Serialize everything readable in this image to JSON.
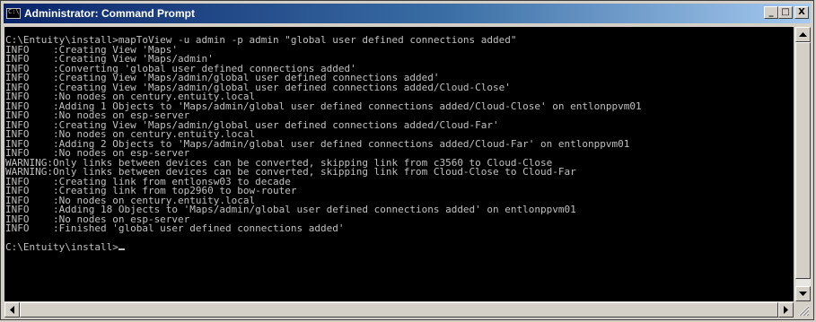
{
  "window": {
    "title": "Administrator: Command Prompt",
    "app_icon_text": "C:\\",
    "buttons": {
      "minimize": "_",
      "maximize": "□",
      "close": "X"
    }
  },
  "console": {
    "lines": [
      "C:\\Entuity\\install>mapToView -u admin -p admin \"global user defined connections added\"",
      "INFO    :Creating View 'Maps'",
      "INFO    :Creating View 'Maps/admin'",
      "INFO    :Converting 'global user defined connections added'",
      "INFO    :Creating View 'Maps/admin/global user defined connections added'",
      "INFO    :Creating View 'Maps/admin/global user defined connections added/Cloud-Close'",
      "INFO    :No nodes on century.entuity.local",
      "INFO    :Adding 1 Objects to 'Maps/admin/global user defined connections added/Cloud-Close' on entlonppvm01",
      "INFO    :No nodes on esp-server",
      "INFO    :Creating View 'Maps/admin/global user defined connections added/Cloud-Far'",
      "INFO    :No nodes on century.entuity.local",
      "INFO    :Adding 2 Objects to 'Maps/admin/global user defined connections added/Cloud-Far' on entlonppvm01",
      "INFO    :No nodes on esp-server",
      "WARNING:Only links between devices can be converted, skipping link from c3560 to Cloud-Close",
      "WARNING:Only links between devices can be converted, skipping link from Cloud-Close to Cloud-Far",
      "INFO    :Creating link from entlonsw03 to decade",
      "INFO    :Creating link from top2960 to bow-router",
      "INFO    :No nodes on century.entuity.local",
      "INFO    :Adding 18 Objects to 'Maps/admin/global user defined connections added' on entlonppvm01",
      "INFO    :No nodes on esp-server",
      "INFO    :Finished 'global user defined connections added'",
      "",
      "C:\\Entuity\\install>"
    ]
  },
  "colors": {
    "console_background": "#000000",
    "console_text": "#c0c0c0",
    "titlebar_start": "#0a246a",
    "titlebar_end": "#a6caf0",
    "titlebar_text": "#ffffff"
  },
  "icons": {
    "app": "console-app-icon",
    "scroll_up": "arrow-up-icon",
    "scroll_down": "arrow-down-icon",
    "scroll_left": "arrow-left-icon",
    "scroll_right": "arrow-right-icon",
    "resize": "resize-grip-icon"
  }
}
